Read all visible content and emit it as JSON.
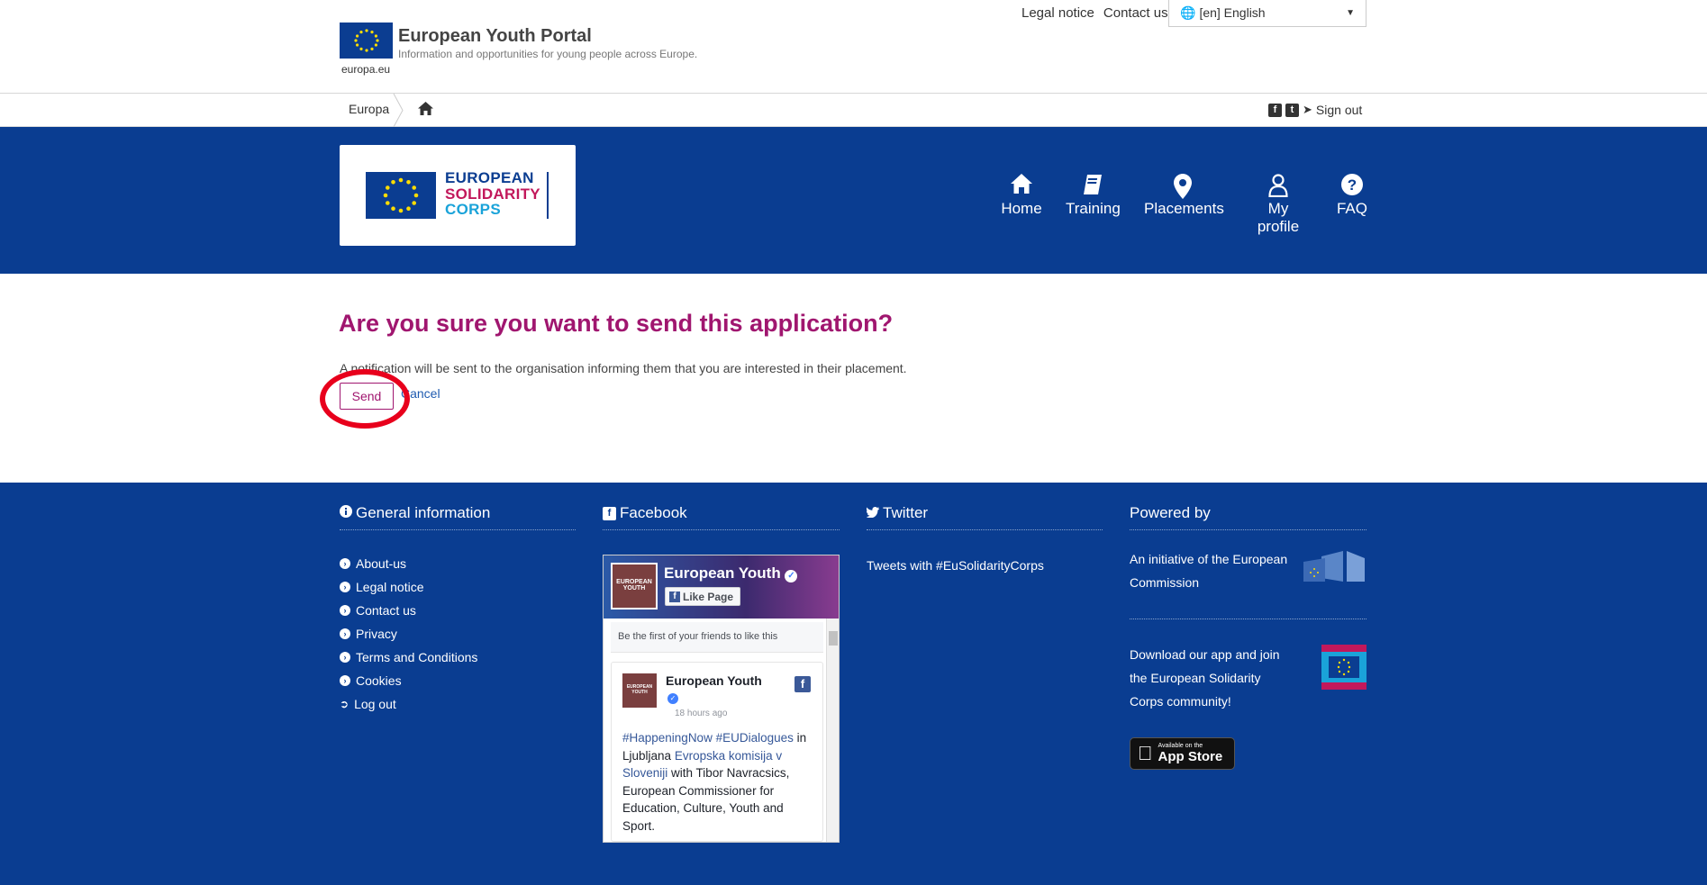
{
  "header": {
    "europa_label": "europa.eu",
    "portal_title": "European Youth Portal",
    "portal_subtitle": "Information and opportunities for young people across Europe.",
    "legal_notice": "Legal notice",
    "contact_us": "Contact us",
    "language": "[en] English"
  },
  "breadcrumb": {
    "europa": "Europa",
    "sign_out": "Sign out"
  },
  "banner": {
    "logo_line1": "EUROPEAN",
    "logo_line2": "SOLIDARITY",
    "logo_line3": "CORPS",
    "nav": [
      {
        "label": "Home",
        "icon": "home-icon"
      },
      {
        "label": "Training",
        "icon": "book-icon"
      },
      {
        "label": "Placements",
        "icon": "map-marker-icon"
      },
      {
        "label": "My profile",
        "icon": "user-icon"
      },
      {
        "label": "FAQ",
        "icon": "question-circle-icon"
      }
    ]
  },
  "main": {
    "title": "Are you sure you want to send this application?",
    "notice": "A notification will be sent to the organisation informing them that you are interested in their placement.",
    "send_label": "Send",
    "cancel_label": "Cancel"
  },
  "footer": {
    "general": {
      "heading": "General information",
      "links": [
        "About-us",
        "Legal notice",
        "Contact us",
        "Privacy",
        "Terms and Conditions",
        "Cookies",
        "Log out"
      ]
    },
    "facebook": {
      "heading": "Facebook",
      "page_name": "European Youth",
      "like_label": "Like Page",
      "friends_text": "Be the first of your friends to like this",
      "post_name": "European Youth",
      "post_time": "18 hours ago",
      "post_hashtags": "#HappeningNow #EUDialogues",
      "post_in": "in Ljubljana",
      "post_link": "Evropska komisija v Sloveniji",
      "post_rest": "with Tibor Navracsics, European Commissioner for Education, Culture, Youth and Sport.",
      "thumb_text": "EUROPEAN YOUTH"
    },
    "twitter": {
      "heading": "Twitter",
      "text": "Tweets with #EuSolidarityCorps"
    },
    "powered": {
      "heading": "Powered by",
      "initiative": "An initiative of the European Commission",
      "download": "Download our app and join the European Solidarity Corps community!",
      "appstore_small": "Available on the",
      "appstore_big": "App Store"
    }
  },
  "colors": {
    "blue": "#0a3d91",
    "magenta": "#a0166f",
    "highlight_red": "#e8001c"
  }
}
